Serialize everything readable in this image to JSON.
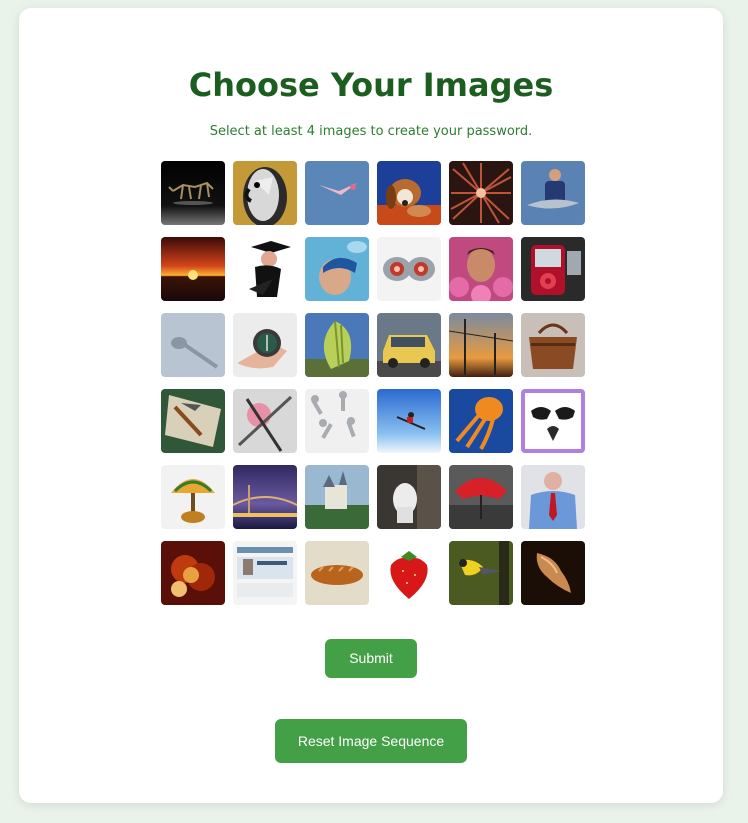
{
  "page": {
    "title": "Choose Your Images",
    "subtitle": "Select at least 4 images to create your password."
  },
  "images": [
    {
      "name": "dinosaur-skeleton-image"
    },
    {
      "name": "parrot-image"
    },
    {
      "name": "flamingo-image"
    },
    {
      "name": "beagle-dog-image"
    },
    {
      "name": "firework-burst-image"
    },
    {
      "name": "man-holding-fish-image"
    },
    {
      "name": "sunset-sea-image"
    },
    {
      "name": "graduate-image"
    },
    {
      "name": "swimmer-image"
    },
    {
      "name": "binoculars-image"
    },
    {
      "name": "man-in-flowers-image"
    },
    {
      "name": "red-ipod-image"
    },
    {
      "name": "ladle-image"
    },
    {
      "name": "compass-in-hand-image"
    },
    {
      "name": "parachute-image"
    },
    {
      "name": "yellow-taxi-image"
    },
    {
      "name": "power-lines-sunset-image"
    },
    {
      "name": "leather-handbag-image"
    },
    {
      "name": "hammer-and-papers-image"
    },
    {
      "name": "swords-image"
    },
    {
      "name": "bolts-image"
    },
    {
      "name": "skier-jump-image"
    },
    {
      "name": "orange-octopus-image"
    },
    {
      "name": "glasses-frame-image"
    },
    {
      "name": "tiffany-lamp-image"
    },
    {
      "name": "bridge-at-night-image"
    },
    {
      "name": "castle-image"
    },
    {
      "name": "toilet-image"
    },
    {
      "name": "red-umbrella-image"
    },
    {
      "name": "man-in-suit-image"
    },
    {
      "name": "food-platter-image"
    },
    {
      "name": "website-screenshot-image"
    },
    {
      "name": "bread-loaf-image"
    },
    {
      "name": "strawberry-image"
    },
    {
      "name": "bird-on-branch-image"
    },
    {
      "name": "brown-creature-image"
    }
  ],
  "buttons": {
    "submit": "Submit",
    "reset": "Reset Image Sequence"
  },
  "colors": {
    "background": "#e9f3ea",
    "title": "#1b5e20",
    "subtitle": "#2e7d32",
    "button": "#43a047"
  }
}
